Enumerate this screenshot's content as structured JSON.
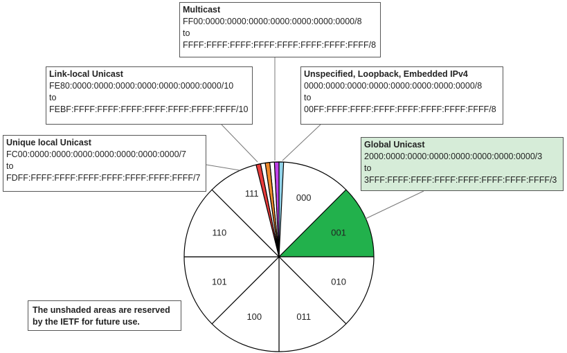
{
  "boxes": {
    "multicast": {
      "title": "Multicast",
      "start": "FF00:0000:0000:0000:0000:0000:0000:0000/8",
      "to": "to",
      "end": "FFFF:FFFF:FFFF:FFFF:FFFF:FFFF:FFFF:FFFF/8"
    },
    "link_local": {
      "title": "Link-local Unicast",
      "start": "FE80:0000:0000:0000:0000:0000:0000:0000/10",
      "to": "to",
      "end": "FEBF:FFFF:FFFF:FFFF:FFFF:FFFF:FFFF:FFFF/10"
    },
    "unspecified": {
      "title": "Unspecified, Loopback, Embedded IPv4",
      "start": "0000:0000:0000:0000:0000:0000:0000:0000/8",
      "to": "to",
      "end": "00FF:FFFF:FFFF:FFFF:FFFF:FFFF:FFFF:FFFF/8"
    },
    "unique_local": {
      "title": "Unique local Unicast",
      "start": "FC00:0000:0000:0000:0000:0000:0000:0000/7",
      "to": "to",
      "end": "FDFF:FFFF:FFFF:FFFF:FFFF:FFFF:FFFF:FFFF/7"
    },
    "global": {
      "title": "Global Unicast",
      "start": "2000:0000:0000:0000:0000:0000:0000:0000/3",
      "to": "to",
      "end": "3FFF:FFFF:FFFF:FFFF:FFFF:FFFF:FFFF:FFFF/3"
    }
  },
  "note": "The unshaded areas are reserved by the IETF for future use.",
  "pie": {
    "segments": [
      {
        "label": "000",
        "fill": "#ffffff"
      },
      {
        "label": "001",
        "fill": "#22b14c"
      },
      {
        "label": "010",
        "fill": "#ffffff"
      },
      {
        "label": "011",
        "fill": "#ffffff"
      },
      {
        "label": "100",
        "fill": "#ffffff"
      },
      {
        "label": "101",
        "fill": "#ffffff"
      },
      {
        "label": "110",
        "fill": "#ffffff"
      },
      {
        "label": "111",
        "fill": "#ffffff"
      }
    ],
    "slivers": [
      {
        "name": "unspecified",
        "fill": "#92d4ea"
      },
      {
        "name": "multicast",
        "fill": "#c040e8"
      },
      {
        "name": "link-local",
        "fill": "#ffffff"
      },
      {
        "name": "unique-local",
        "fill": "#f08a2c"
      },
      {
        "name": "unassigned-111",
        "fill": "#ffffff"
      },
      {
        "name": "red",
        "fill": "#e83c3c"
      }
    ]
  }
}
